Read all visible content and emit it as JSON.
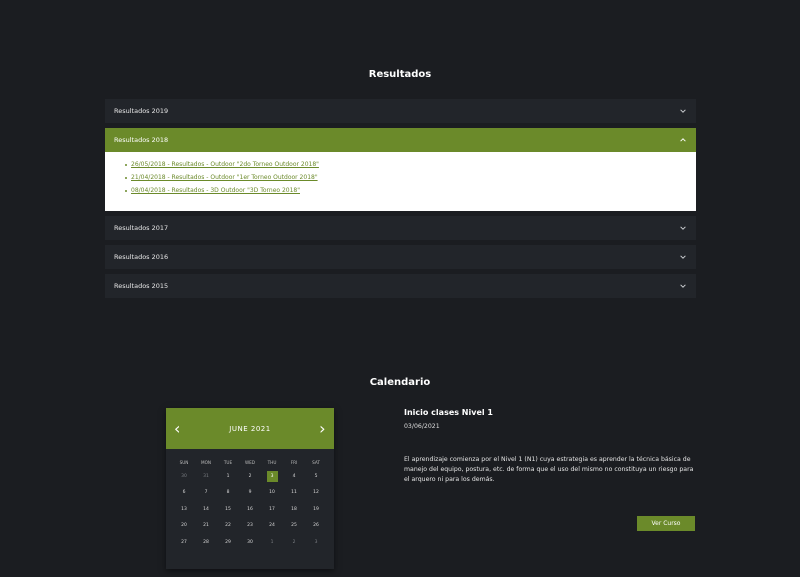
{
  "resultados": {
    "title": "Resultados",
    "items": [
      {
        "label": "Resultados 2019"
      },
      {
        "label": "Resultados 2018",
        "links": [
          "26/05/2018 - Resultados - Outdoor \"2do Torneo Outdoor 2018\"",
          "21/04/2018 - Resultados - Outdoor \"1er Torneo Outdoor 2018\"",
          "08/04/2018 - Resultados - 3D Outdoor \"3D Torneo 2018\""
        ]
      },
      {
        "label": "Resultados 2017"
      },
      {
        "label": "Resultados 2016"
      },
      {
        "label": "Resultados 2015"
      }
    ]
  },
  "calendario": {
    "title": "Calendario",
    "month_label": "JUNE  2021",
    "prev_icon": "‹",
    "next_icon": "›",
    "weekdays": [
      "SUN",
      "MON",
      "TUE",
      "WED",
      "THU",
      "FRI",
      "SAT"
    ],
    "days": [
      {
        "n": "30",
        "dim": true
      },
      {
        "n": "31",
        "dim": true
      },
      {
        "n": "1"
      },
      {
        "n": "2"
      },
      {
        "n": "3",
        "selected": true
      },
      {
        "n": "4"
      },
      {
        "n": "5"
      },
      {
        "n": "6"
      },
      {
        "n": "7"
      },
      {
        "n": "8"
      },
      {
        "n": "9"
      },
      {
        "n": "10"
      },
      {
        "n": "11"
      },
      {
        "n": "12"
      },
      {
        "n": "13"
      },
      {
        "n": "14"
      },
      {
        "n": "15"
      },
      {
        "n": "16"
      },
      {
        "n": "17"
      },
      {
        "n": "18"
      },
      {
        "n": "19"
      },
      {
        "n": "20"
      },
      {
        "n": "21"
      },
      {
        "n": "22"
      },
      {
        "n": "23"
      },
      {
        "n": "24"
      },
      {
        "n": "25"
      },
      {
        "n": "26"
      },
      {
        "n": "27"
      },
      {
        "n": "28"
      },
      {
        "n": "29"
      },
      {
        "n": "30"
      },
      {
        "n": "1",
        "dim": true
      },
      {
        "n": "2",
        "dim": true
      },
      {
        "n": "3",
        "dim": true
      }
    ]
  },
  "event": {
    "title": "Inicio clases Nivel 1",
    "date": "03/06/2021",
    "description": "El aprendizaje comienza por el Nivel 1 (N1) cuya estrategia es aprender la técnica básica de manejo del equipo, postura, etc. de forma que el uso del mismo no constituya un riesgo para el arquero ni para los demás.",
    "button": "Ver Curso"
  },
  "colors": {
    "accent": "#6b8a2a",
    "background": "#1b1d21",
    "panel": "#22252a"
  }
}
